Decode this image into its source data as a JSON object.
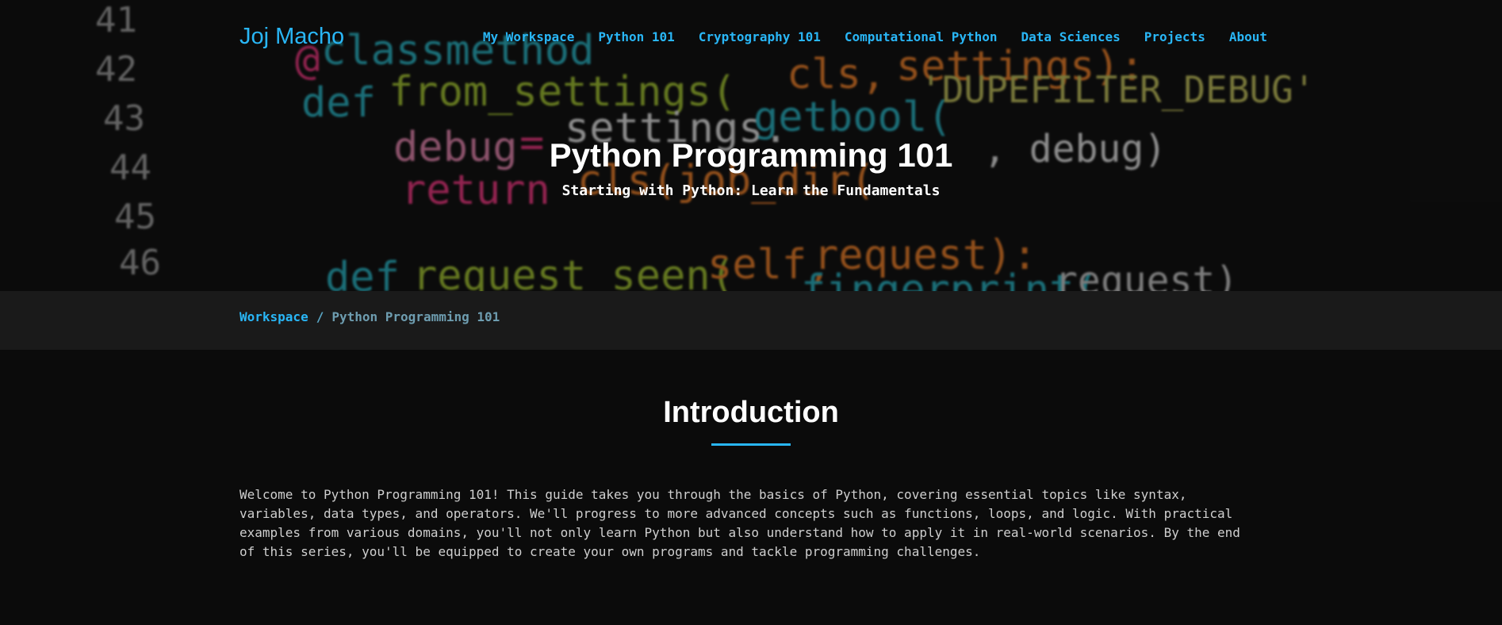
{
  "brand": {
    "name": "Joj Macho"
  },
  "nav": {
    "items": [
      {
        "label": "My Workspace"
      },
      {
        "label": "Python 101"
      },
      {
        "label": "Cryptography 101"
      },
      {
        "label": "Computational Python"
      },
      {
        "label": "Data Sciences"
      },
      {
        "label": "Projects"
      },
      {
        "label": "About"
      }
    ]
  },
  "hero": {
    "title": "Python Programming 101",
    "subtitle": "Starting with Python: Learn the Fundamentals"
  },
  "breadcrumb": {
    "parent": "Workspace",
    "separator": "/",
    "current": "Python Programming 101"
  },
  "content": {
    "section_title": "Introduction",
    "paragraph": "Welcome to Python Programming 101! This guide takes you through the basics of Python, covering essential topics like syntax, variables, data types, and operators. We'll progress to more advanced concepts such as functions, loops, and logic. With practical examples from various domains, you'll not only learn Python but also understand how to apply it in real-world scenarios. By the end of this series, you'll be equipped to create your own programs and tackle programming challenges."
  },
  "colors": {
    "accent": "#29b6f6",
    "page_background": "#0b0b0b",
    "breadcrumb_background": "#1a1a1a"
  }
}
